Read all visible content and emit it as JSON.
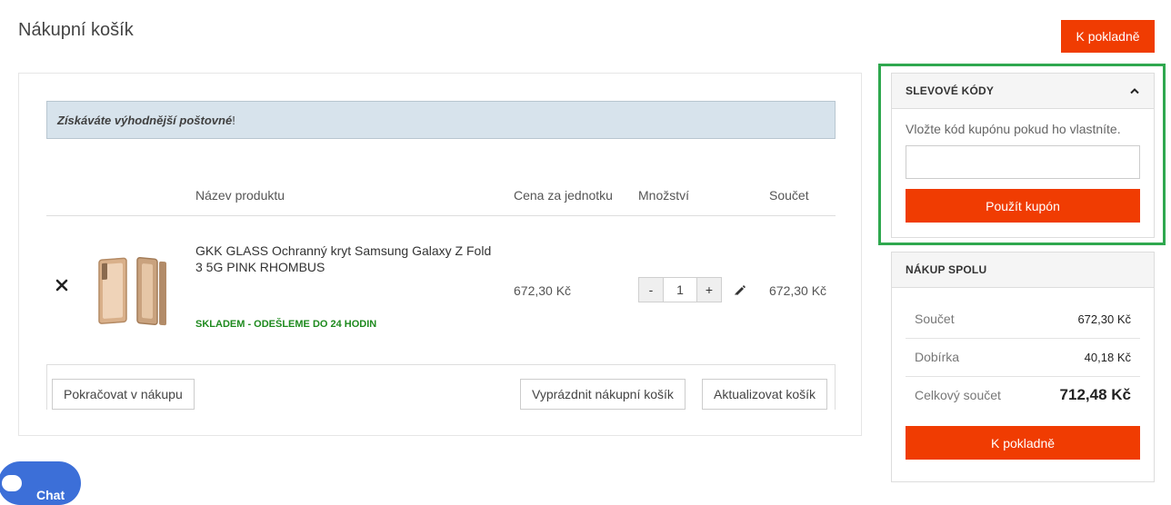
{
  "page": {
    "title": "Nákupní košík"
  },
  "header": {
    "checkout_label": "K pokladně"
  },
  "cart": {
    "banner_strong": "Získáváte výhodnější poštovné",
    "banner_rest": "!",
    "columns": {
      "product": "Název produktu",
      "unit_price": "Cena za jednotku",
      "quantity": "Množství",
      "total": "Součet"
    },
    "item": {
      "name": "GKK GLASS Ochranný kryt Samsung Galaxy Z Fold 3 5G PINK RHOMBUS",
      "stock": "SKLADEM - ODEŠLEME DO 24 HODIN",
      "unit_price": "672,30 Kč",
      "quantity": "1",
      "qty_minus": "-",
      "qty_plus": "+",
      "total": "672,30 Kč"
    },
    "actions": {
      "continue": "Pokračovat v nákupu",
      "empty": "Vyprázdnit nákupní košík",
      "update": "Aktualizovat košík"
    }
  },
  "coupon": {
    "title": "SLEVOVÉ KÓDY",
    "hint": "Vložte kód kupónu pokud ho vlastníte.",
    "input_value": "",
    "apply_label": "Použít kupón"
  },
  "summary": {
    "title": "NÁKUP SPOLU",
    "rows": [
      {
        "label": "Součet",
        "value": "672,30 Kč"
      },
      {
        "label": "Dobírka",
        "value": "40,18 Kč"
      },
      {
        "label": "Celkový součet",
        "value": "712,48 Kč"
      }
    ],
    "checkout_label": "K pokladně"
  },
  "chat": {
    "label": "Chat"
  },
  "colors": {
    "accent": "#f03c02",
    "stock_green": "#1e8a1e",
    "highlight": "#2fa84f",
    "banner_bg": "#d7e3ec",
    "chat_blue": "#3c6fd8"
  },
  "icons": {
    "remove": "close-icon",
    "edit": "pencil-icon",
    "collapse": "chevron-up-icon",
    "chat": "chat-bubble-icon"
  }
}
